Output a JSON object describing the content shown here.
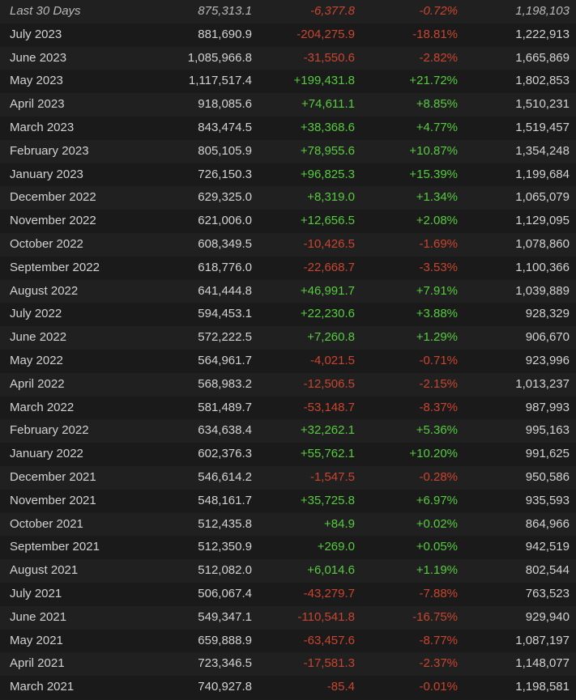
{
  "colors": {
    "positive": "#57cb3f",
    "negative": "#c9452f",
    "text": "#d2d2d2",
    "row_bg_a": "#202020",
    "row_bg_b": "#1a1a1a"
  },
  "rows": [
    {
      "month": "Last 30 Days",
      "avg": "875,313.1",
      "gain": "-6,377.8",
      "pct": "-0.72%",
      "peak": "1,198,103",
      "trend": "neg"
    },
    {
      "month": "July 2023",
      "avg": "881,690.9",
      "gain": "-204,275.9",
      "pct": "-18.81%",
      "peak": "1,222,913",
      "trend": "neg"
    },
    {
      "month": "June 2023",
      "avg": "1,085,966.8",
      "gain": "-31,550.6",
      "pct": "-2.82%",
      "peak": "1,665,869",
      "trend": "neg"
    },
    {
      "month": "May 2023",
      "avg": "1,117,517.4",
      "gain": "+199,431.8",
      "pct": "+21.72%",
      "peak": "1,802,853",
      "trend": "pos"
    },
    {
      "month": "April 2023",
      "avg": "918,085.6",
      "gain": "+74,611.1",
      "pct": "+8.85%",
      "peak": "1,510,231",
      "trend": "pos"
    },
    {
      "month": "March 2023",
      "avg": "843,474.5",
      "gain": "+38,368.6",
      "pct": "+4.77%",
      "peak": "1,519,457",
      "trend": "pos"
    },
    {
      "month": "February 2023",
      "avg": "805,105.9",
      "gain": "+78,955.6",
      "pct": "+10.87%",
      "peak": "1,354,248",
      "trend": "pos"
    },
    {
      "month": "January 2023",
      "avg": "726,150.3",
      "gain": "+96,825.3",
      "pct": "+15.39%",
      "peak": "1,199,684",
      "trend": "pos"
    },
    {
      "month": "December 2022",
      "avg": "629,325.0",
      "gain": "+8,319.0",
      "pct": "+1.34%",
      "peak": "1,065,079",
      "trend": "pos"
    },
    {
      "month": "November 2022",
      "avg": "621,006.0",
      "gain": "+12,656.5",
      "pct": "+2.08%",
      "peak": "1,129,095",
      "trend": "pos"
    },
    {
      "month": "October 2022",
      "avg": "608,349.5",
      "gain": "-10,426.5",
      "pct": "-1.69%",
      "peak": "1,078,860",
      "trend": "neg"
    },
    {
      "month": "September 2022",
      "avg": "618,776.0",
      "gain": "-22,668.7",
      "pct": "-3.53%",
      "peak": "1,100,366",
      "trend": "neg"
    },
    {
      "month": "August 2022",
      "avg": "641,444.8",
      "gain": "+46,991.7",
      "pct": "+7.91%",
      "peak": "1,039,889",
      "trend": "pos"
    },
    {
      "month": "July 2022",
      "avg": "594,453.1",
      "gain": "+22,230.6",
      "pct": "+3.88%",
      "peak": "928,329",
      "trend": "pos"
    },
    {
      "month": "June 2022",
      "avg": "572,222.5",
      "gain": "+7,260.8",
      "pct": "+1.29%",
      "peak": "906,670",
      "trend": "pos"
    },
    {
      "month": "May 2022",
      "avg": "564,961.7",
      "gain": "-4,021.5",
      "pct": "-0.71%",
      "peak": "923,996",
      "trend": "neg"
    },
    {
      "month": "April 2022",
      "avg": "568,983.2",
      "gain": "-12,506.5",
      "pct": "-2.15%",
      "peak": "1,013,237",
      "trend": "neg"
    },
    {
      "month": "March 2022",
      "avg": "581,489.7",
      "gain": "-53,148.7",
      "pct": "-8.37%",
      "peak": "987,993",
      "trend": "neg"
    },
    {
      "month": "February 2022",
      "avg": "634,638.4",
      "gain": "+32,262.1",
      "pct": "+5.36%",
      "peak": "995,163",
      "trend": "pos"
    },
    {
      "month": "January 2022",
      "avg": "602,376.3",
      "gain": "+55,762.1",
      "pct": "+10.20%",
      "peak": "991,625",
      "trend": "pos"
    },
    {
      "month": "December 2021",
      "avg": "546,614.2",
      "gain": "-1,547.5",
      "pct": "-0.28%",
      "peak": "950,586",
      "trend": "neg"
    },
    {
      "month": "November 2021",
      "avg": "548,161.7",
      "gain": "+35,725.8",
      "pct": "+6.97%",
      "peak": "935,593",
      "trend": "pos"
    },
    {
      "month": "October 2021",
      "avg": "512,435.8",
      "gain": "+84.9",
      "pct": "+0.02%",
      "peak": "864,966",
      "trend": "pos"
    },
    {
      "month": "September 2021",
      "avg": "512,350.9",
      "gain": "+269.0",
      "pct": "+0.05%",
      "peak": "942,519",
      "trend": "pos"
    },
    {
      "month": "August 2021",
      "avg": "512,082.0",
      "gain": "+6,014.6",
      "pct": "+1.19%",
      "peak": "802,544",
      "trend": "pos"
    },
    {
      "month": "July 2021",
      "avg": "506,067.4",
      "gain": "-43,279.7",
      "pct": "-7.88%",
      "peak": "763,523",
      "trend": "neg"
    },
    {
      "month": "June 2021",
      "avg": "549,347.1",
      "gain": "-110,541.8",
      "pct": "-16.75%",
      "peak": "929,940",
      "trend": "neg"
    },
    {
      "month": "May 2021",
      "avg": "659,888.9",
      "gain": "-63,457.6",
      "pct": "-8.77%",
      "peak": "1,087,197",
      "trend": "neg"
    },
    {
      "month": "April 2021",
      "avg": "723,346.5",
      "gain": "-17,581.3",
      "pct": "-2.37%",
      "peak": "1,148,077",
      "trend": "neg"
    },
    {
      "month": "March 2021",
      "avg": "740,927.8",
      "gain": "-85.4",
      "pct": "-0.01%",
      "peak": "1,198,581",
      "trend": "neg"
    }
  ]
}
